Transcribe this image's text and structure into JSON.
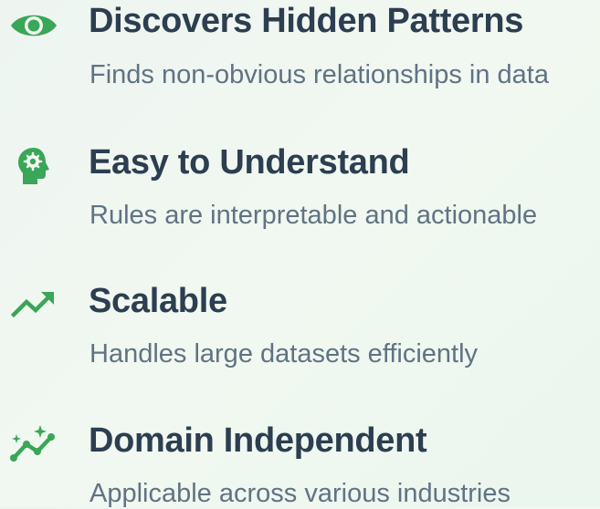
{
  "accent_color": "#3aa657",
  "features": [
    {
      "icon": "eye-icon",
      "title": "Discovers Hidden Patterns",
      "description": "Finds non-obvious relationships in data"
    },
    {
      "icon": "head-gear-icon",
      "title": "Easy to Understand",
      "description": "Rules are interpretable and actionable"
    },
    {
      "icon": "trending-up-icon",
      "title": "Scalable",
      "description": "Handles large datasets efficiently"
    },
    {
      "icon": "sparkle-chart-icon",
      "title": "Domain Independent",
      "description": "Applicable across various industries"
    }
  ]
}
